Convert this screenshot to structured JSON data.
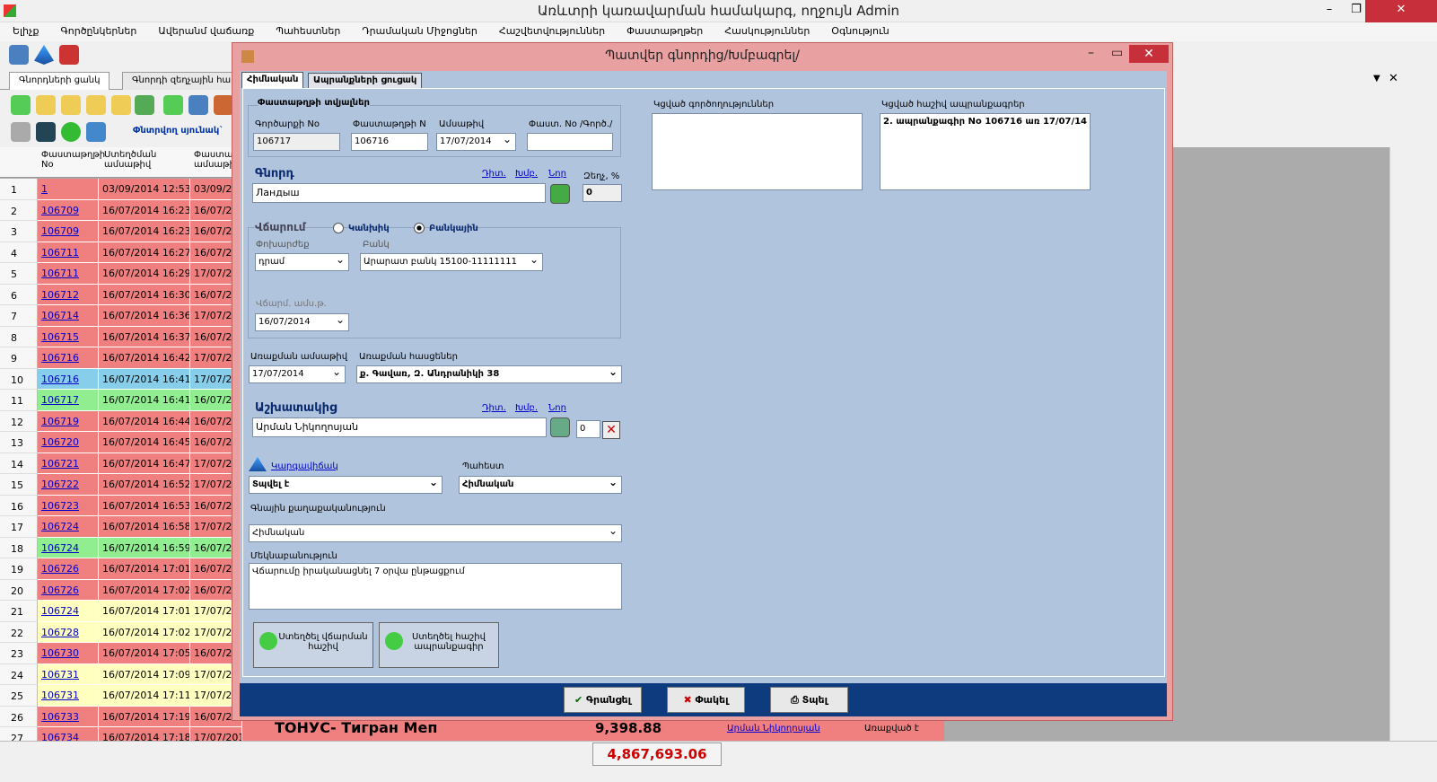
{
  "app": {
    "title": "Առևտրի կառավարման համակարգ, ողջույն Admin"
  },
  "menu": [
    "Ելիչք",
    "Գործընկերներ",
    "Ավերանմ վաճառք",
    "Պահեստներ",
    "Դրամական Միջոցներ",
    "Հաշվետվություններ",
    "Փաստաթղթեր",
    "Հասկություններ",
    "Օգնություն"
  ],
  "tabs": [
    "Գնորդների ցանկ",
    "Գնորդի զեղչային հա"
  ],
  "toolbar": {
    "select_text": "Փնտրվող սյունակ`"
  },
  "grid": {
    "headers": [
      "Փաստաթղթի No",
      "Ստեղծման ամսաթիվ",
      "Փաստա ամսաթի"
    ],
    "rows": [
      {
        "n": "1",
        "doc": "1",
        "date": "03/09/2014 12:53",
        "d2": "03/09/201",
        "color": "#f08080"
      },
      {
        "n": "2",
        "doc": "106709",
        "date": "16/07/2014 16:23",
        "d2": "16/07/201",
        "color": "#f08080"
      },
      {
        "n": "3",
        "doc": "106709",
        "date": "16/07/2014 16:23",
        "d2": "16/07/201",
        "color": "#f08080"
      },
      {
        "n": "4",
        "doc": "106711",
        "date": "16/07/2014 16:27",
        "d2": "16/07/201",
        "color": "#f08080"
      },
      {
        "n": "5",
        "doc": "106711",
        "date": "16/07/2014 16:29",
        "d2": "17/07/201",
        "color": "#f08080"
      },
      {
        "n": "6",
        "doc": "106712",
        "date": "16/07/2014 16:30",
        "d2": "16/07/201",
        "color": "#f08080"
      },
      {
        "n": "7",
        "doc": "106714",
        "date": "16/07/2014 16:36",
        "d2": "17/07/201",
        "color": "#f08080"
      },
      {
        "n": "8",
        "doc": "106715",
        "date": "16/07/2014 16:37",
        "d2": "16/07/201",
        "color": "#f08080"
      },
      {
        "n": "9",
        "doc": "106716",
        "date": "16/07/2014 16:42",
        "d2": "17/07/201",
        "color": "#f08080"
      },
      {
        "n": "10",
        "doc": "106716",
        "date": "16/07/2014 16:41",
        "d2": "17/07/201",
        "color": "#87ceeb"
      },
      {
        "n": "11",
        "doc": "106717",
        "date": "16/07/2014 16:41",
        "d2": "16/07/201",
        "color": "#90ee90"
      },
      {
        "n": "12",
        "doc": "106719",
        "date": "16/07/2014 16:44",
        "d2": "16/07/201",
        "color": "#f08080"
      },
      {
        "n": "13",
        "doc": "106720",
        "date": "16/07/2014 16:45",
        "d2": "16/07/201",
        "color": "#f08080"
      },
      {
        "n": "14",
        "doc": "106721",
        "date": "16/07/2014 16:47",
        "d2": "17/07/201",
        "color": "#f08080"
      },
      {
        "n": "15",
        "doc": "106722",
        "date": "16/07/2014 16:52",
        "d2": "17/07/201",
        "color": "#f08080"
      },
      {
        "n": "16",
        "doc": "106723",
        "date": "16/07/2014 16:53",
        "d2": "16/07/201",
        "color": "#f08080"
      },
      {
        "n": "17",
        "doc": "106724",
        "date": "16/07/2014 16:58",
        "d2": "17/07/201",
        "color": "#f08080"
      },
      {
        "n": "18",
        "doc": "106724",
        "date": "16/07/2014 16:59",
        "d2": "16/07/201",
        "color": "#90ee90"
      },
      {
        "n": "19",
        "doc": "106726",
        "date": "16/07/2014 17:01",
        "d2": "16/07/201",
        "color": "#f08080"
      },
      {
        "n": "20",
        "doc": "106726",
        "date": "16/07/2014 17:02",
        "d2": "16/07/201",
        "color": "#f08080"
      },
      {
        "n": "21",
        "doc": "106724",
        "date": "16/07/2014 17:01",
        "d2": "17/07/201",
        "color": "#ffffc0"
      },
      {
        "n": "22",
        "doc": "106728",
        "date": "16/07/2014 17:02",
        "d2": "17/07/201",
        "color": "#ffffc0"
      },
      {
        "n": "23",
        "doc": "106730",
        "date": "16/07/2014 17:05",
        "d2": "16/07/201",
        "color": "#f08080"
      },
      {
        "n": "24",
        "doc": "106731",
        "date": "16/07/2014 17:09",
        "d2": "17/07/201",
        "color": "#ffffc0"
      },
      {
        "n": "25",
        "doc": "106731",
        "date": "16/07/2014 17:11",
        "d2": "17/07/201",
        "color": "#ffffc0"
      },
      {
        "n": "26",
        "doc": "106733",
        "date": "16/07/2014 17:19",
        "d2": "16/07/201",
        "color": "#f08080"
      },
      {
        "n": "27",
        "doc": "106734",
        "date": "16/07/2014 17:18",
        "d2": "17/07/2014",
        "color": "#f08080"
      }
    ],
    "last_row_extra": {
      "name": "ТОНУС- Тигран Меп",
      "amount": "9,398.88",
      "user": "Արման Նիկողոսյան",
      "status": "Առաքված է"
    }
  },
  "status": {
    "total": "4,867,693.06"
  },
  "dialog": {
    "title": "Պատվեր գնորդից/Խմբագրել/",
    "tabs": [
      "Հիմնական",
      "Ապրանքների ցուցակ"
    ],
    "doc_group": "Փաստաթղթի տվյալներ",
    "partner_no_label": "Գործարքի No",
    "partner_no": "106717",
    "doc_n_label": "Փաստաթղթի N",
    "doc_n": "106716",
    "date_label": "Ամսաթիվ",
    "date": "17/07/2014",
    "ext_no_label": "Փաստ. No /Գործ./",
    "ext_no": "",
    "buyer_label": "Գնորդ",
    "buyer": "Ландыш",
    "link_view": "Դիտ.",
    "link_edit": "Խմբ.",
    "link_new": "Նոր",
    "discount_label": "Զեղչ, %",
    "discount": "0",
    "payment_label": "Վճարում",
    "cash_label": "Կանխիկ",
    "bank_label": "Բանկային",
    "currency_label": "Փոխարժեք",
    "currency": "դրամ",
    "bank_field_label": "Բանկ",
    "bank": "Արարատ բանկ 15100-11111111",
    "pay_date_label": "Վճարմ. ամս.թ.",
    "pay_date": "16/07/2014",
    "delivery_date_label": "Առաքման ամսաթիվ",
    "delivery_date": "17/07/2014",
    "delivery_addr_label": "Առաքման հասցեներ",
    "delivery_addr": "ք. Գավառ, Զ. Անդրանիկի 38",
    "employee_label": "Աշխատակից",
    "employee": "Արման Նիկողոսյան",
    "employee_val": "0",
    "status_link": "Կարգավիճակ",
    "status": "Տպվել է",
    "warehouse_label": "Պահեստ",
    "warehouse": "Հիմնական",
    "price_policy_label": "Գնային քաղաքականություն",
    "price_policy": "Հիմնական",
    "comment_label": "Մեկնաբանություն",
    "comment": "Վճարումը իրականացնել 7 օրվա ընթացքում",
    "linked_ops_label": "Կցված գործողություններ",
    "linked_invoices_label": "Կցված հաշիվ ապրանքագրեր",
    "linked_invoice": "2. ապրանքագիր No 106716 առ 17/07/14",
    "btn_create_pay": "Ստեղծել վճարման հաշիվ",
    "btn_create_inv": "Ստեղծել հաշիվ ապրանքագիր",
    "btn_save": "Գրանցել",
    "btn_close": "Փակել",
    "btn_print": "Տպել"
  }
}
